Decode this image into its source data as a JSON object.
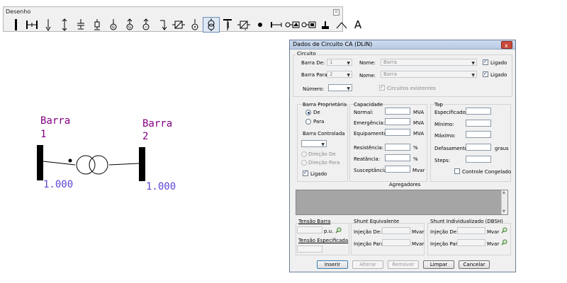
{
  "toolbar": {
    "title": "Desenho",
    "tools": [
      {
        "icon": "bus-bar-icon"
      },
      {
        "icon": "ac-circuit-icon"
      },
      {
        "icon": "load-icon"
      },
      {
        "icon": "generator-bar-icon"
      },
      {
        "icon": "capacitor-icon"
      },
      {
        "icon": "shunt-reactor-icon"
      },
      {
        "icon": "synchronous-machine-icon"
      },
      {
        "icon": "induction-machine-icon"
      },
      {
        "icon": "generator-icon"
      },
      {
        "icon": "dc-line-icon"
      },
      {
        "icon": "converter-icon"
      },
      {
        "icon": "current-source-icon"
      },
      {
        "icon": "transformer-icon"
      },
      {
        "icon": "three-winding-transformer-icon"
      },
      {
        "icon": "svc-icon"
      },
      {
        "icon": "node-icon"
      },
      {
        "icon": "series-element-icon"
      },
      {
        "icon": "facts-device-icon"
      },
      {
        "icon": "facts-shunt-icon"
      },
      {
        "icon": "ground-icon"
      },
      {
        "icon": "angle-line-icon"
      },
      {
        "icon": "text-tool-icon",
        "label": "A"
      }
    ]
  },
  "diagram": {
    "bus1": {
      "name": "Barra",
      "number": "1",
      "voltage": "1.000"
    },
    "bus2": {
      "name": "Barra",
      "number": "2",
      "voltage": "1.000"
    }
  },
  "dialog": {
    "title": "Dados de Circuito CA (DLIN)",
    "close": "x",
    "circuito": {
      "group_label": "Circuito",
      "barra_de_label": "Barra De:",
      "barra_de_value": "1",
      "barra_para_label": "Barra Para:",
      "barra_para_value": "2",
      "nome_label": "Nome:",
      "nome_de_value": "Barra",
      "nome_para_value": "Barra",
      "ligado_label": "Ligado",
      "numero_label": "Número:",
      "numero_value": "",
      "circuitos_existentes_label": "Circuitos existentes"
    },
    "barra_proprietaria": {
      "label": "Barra Proprietária",
      "de": "De",
      "para": "Para"
    },
    "barra_controlada": {
      "label": "Barra Controlada",
      "value": "",
      "direcao_de": "Direção De",
      "direcao_para": "Direção Para",
      "ligado": "Ligado"
    },
    "capacidade": {
      "label": "Capacidade",
      "normal": "Normal:",
      "emergencia": "Emergência:",
      "equipamento": "Equipamento",
      "unit_mva": "MVA",
      "resistencia": "Resistência:",
      "reatancia": "Reatância:",
      "susceptancia": "Susceptância:",
      "unit_pct": "%",
      "unit_mvar": "Mvar"
    },
    "tap": {
      "label": "Tap",
      "especificado": "Especificado:",
      "minimo": "Mínimo:",
      "maximo": "Máximo:",
      "defasamento": "Defasamento:",
      "unit_graus": "graus",
      "steps": "Steps:",
      "controle_congelado": "Controle Congelado"
    },
    "agregadores": {
      "label": "Agregadores"
    },
    "tensao": {
      "tensao_barra": "Tensão Barra",
      "unit_pu": "p.u.",
      "tensao_especificada": "Tensão Especificada"
    },
    "shunt_equivalente": {
      "label": "Shunt Equivalente",
      "injecao_de": "Injeção De:",
      "injecao_para": "Injeção Para:",
      "unit": "Mvar"
    },
    "shunt_individualizado": {
      "label": "Shunt Individualizado (DBSH)",
      "injecao_de": "Injeção De:",
      "injecao_para": "Injeção Para:",
      "unit": "Mvar"
    },
    "buttons": {
      "inserir": "Inserir",
      "alterar": "Alterar",
      "remover": "Remover",
      "limpar": "Limpar",
      "cancelar": "Cancelar"
    }
  }
}
